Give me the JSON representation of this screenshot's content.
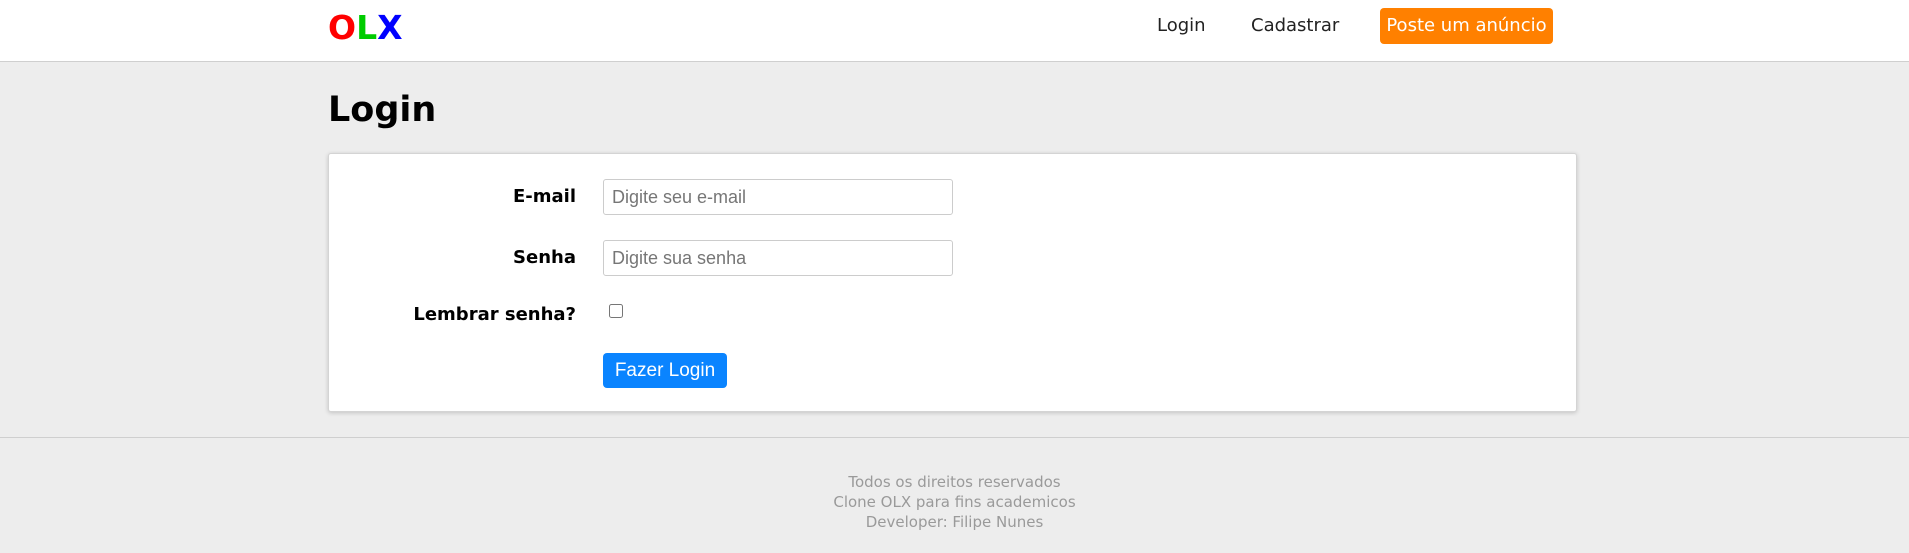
{
  "header": {
    "logo": {
      "letters": [
        {
          "char": "O",
          "color": "#ff0000"
        },
        {
          "char": "L",
          "color": "#00cc00"
        },
        {
          "char": "X",
          "color": "#0000ff"
        }
      ]
    },
    "nav": {
      "login_label": "Login",
      "register_label": "Cadastrar",
      "post_ad_label": "Poste um anúncio"
    }
  },
  "main": {
    "title": "Login",
    "form": {
      "email_label": "E-mail",
      "email_value": "",
      "email_placeholder": "Digite seu e-mail",
      "password_label": "Senha",
      "password_value": "",
      "password_placeholder": "Digite sua senha",
      "remember_label": "Lembrar senha?",
      "remember_checked": false,
      "submit_label": "Fazer Login"
    }
  },
  "footer": {
    "lines": [
      "Todos os direitos reservados",
      "Clone OLX para fins academicos",
      "Developer: Filipe Nunes"
    ]
  },
  "colors": {
    "post_ad_button": "#ff8000",
    "submit_button": "#0a84ff",
    "page_background": "#ededed"
  }
}
